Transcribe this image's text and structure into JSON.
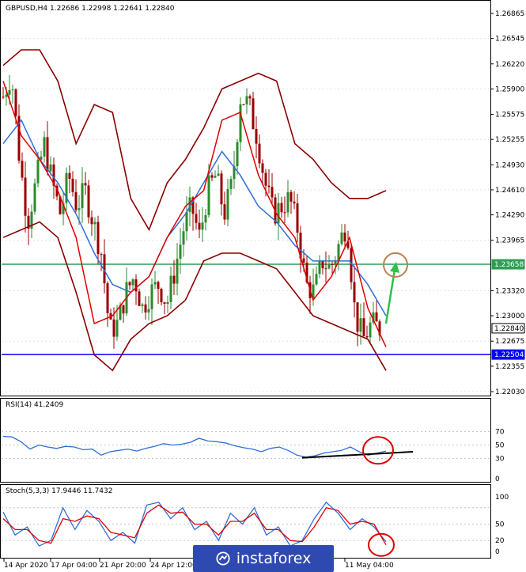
{
  "header": {
    "symbol_line": "GBPUSD,H4  1.22686 1.22998 1.22641 1.22840",
    "rsi_line": "RSI(14) 41.2409",
    "stoch_line": "Stoch(5,3,3) 17.9446 11.7432"
  },
  "price_axis": {
    "ticks": [
      "1.26865",
      "1.26545",
      "1.26220",
      "1.25900",
      "1.25575",
      "1.25255",
      "1.24930",
      "1.24610",
      "1.24290",
      "1.23965",
      "1.23320",
      "1.23000",
      "1.22675",
      "1.22355",
      "1.22030"
    ],
    "tick_values": [
      1.26865,
      1.26545,
      1.2622,
      1.259,
      1.25575,
      1.25255,
      1.2493,
      1.2461,
      1.2429,
      1.23965,
      1.2332,
      1.23,
      1.22675,
      1.22355,
      1.2203
    ],
    "boxes": [
      {
        "label": "1.23658",
        "value": 1.23658,
        "color": "#2e9e55"
      },
      {
        "label": "1.22840",
        "value": 1.2284,
        "color": "#ffffff"
      },
      {
        "label": "1.22504",
        "value": 1.22504,
        "color": "#0000ff"
      }
    ]
  },
  "rsi_axis": {
    "ticks": [
      "70",
      "50",
      "30",
      "0"
    ],
    "tick_values": [
      70,
      50,
      30,
      0
    ]
  },
  "stoch_axis": {
    "ticks": [
      "100",
      "50",
      "20",
      "0"
    ],
    "tick_values": [
      100,
      50,
      20,
      0
    ]
  },
  "time_axis": {
    "labels": [
      "14 Apr 2020",
      "17 Apr 04:00",
      "21 Apr 20:00",
      "24 Apr 12:00",
      "11 May 04:00"
    ]
  },
  "colors": {
    "bullish": "#2d8a2d",
    "bearish": "#9a0000",
    "bollinger": "#8b0000",
    "fast_ma": "#e00000",
    "slow_ma": "#2f6fd8",
    "support": "#0000ff",
    "resistance": "#2e9e55",
    "arrow": "#2fc04a",
    "circle_price": "#c08050",
    "circle_ind": "#e00000"
  },
  "watermark": {
    "text": "instaforex"
  },
  "chart_data": [
    {
      "type": "candlestick",
      "title": "GBPUSD,H4",
      "ylim": [
        1.22,
        1.27
      ],
      "horizontal_lines": [
        1.23658,
        1.22504
      ],
      "close_path": [
        1.258,
        1.261,
        1.25,
        1.242,
        1.247,
        1.252,
        1.247,
        1.243,
        1.248,
        1.244,
        1.246,
        1.242,
        1.238,
        1.228,
        1.229,
        1.233,
        1.235,
        1.231,
        1.233,
        1.234,
        1.2315,
        1.236,
        1.241,
        1.244,
        1.24,
        1.246,
        1.248,
        1.243,
        1.247,
        1.258,
        1.257,
        1.253,
        1.247,
        1.243,
        1.244,
        1.245,
        1.241,
        1.234,
        1.233,
        1.237,
        1.236,
        1.239,
        1.242,
        1.23,
        1.227,
        1.229,
        1.2284
      ],
      "bollinger_upper_path": [
        1.262,
        1.264,
        1.264,
        1.26,
        1.252,
        1.257,
        1.256,
        1.245,
        1.241,
        1.247,
        1.25,
        1.254,
        1.259,
        1.26,
        1.261,
        1.26,
        1.252,
        1.25,
        1.247,
        1.245,
        1.245,
        1.246
      ],
      "bollinger_lower_path": [
        1.24,
        1.241,
        1.242,
        1.24,
        1.233,
        1.225,
        1.223,
        1.227,
        1.229,
        1.23,
        1.232,
        1.237,
        1.238,
        1.238,
        1.237,
        1.236,
        1.233,
        1.23,
        1.229,
        1.228,
        1.227,
        1.223
      ],
      "fast_ma_path": [
        1.26,
        1.253,
        1.25,
        1.246,
        1.24,
        1.229,
        1.23,
        1.233,
        1.235,
        1.24,
        1.244,
        1.246,
        1.255,
        1.256,
        1.248,
        1.243,
        1.24,
        1.232,
        1.235,
        1.24,
        1.231,
        1.226
      ],
      "slow_ma_path": [
        1.252,
        1.255,
        1.25,
        1.247,
        1.243,
        1.238,
        1.234,
        1.233,
        1.235,
        1.24,
        1.243,
        1.247,
        1.251,
        1.248,
        1.244,
        1.242,
        1.239,
        1.237,
        1.237,
        1.237,
        1.234,
        1.23
      ],
      "projection_target": 1.2365
    },
    {
      "type": "line",
      "title": "RSI(14)",
      "ylim": [
        0,
        100
      ],
      "levels": [
        70,
        50,
        30
      ],
      "values": [
        63,
        62,
        55,
        44,
        50,
        47,
        45,
        48,
        47,
        43,
        44,
        35,
        40,
        42,
        44,
        41,
        45,
        48,
        52,
        50,
        51,
        54,
        60,
        56,
        55,
        53,
        49,
        46,
        44,
        40,
        45,
        47,
        42,
        35,
        32,
        34,
        38,
        40,
        42,
        47,
        40,
        35,
        38,
        41
      ],
      "trendline": [
        31,
        40
      ]
    },
    {
      "type": "line",
      "title": "Stoch(5,3,3)",
      "ylim": [
        0,
        100
      ],
      "levels": [
        80,
        50,
        20
      ],
      "main": [
        72,
        30,
        45,
        10,
        20,
        80,
        40,
        75,
        55,
        20,
        35,
        15,
        85,
        90,
        60,
        80,
        40,
        55,
        20,
        70,
        50,
        80,
        30,
        45,
        10,
        20,
        60,
        90,
        70,
        40,
        60,
        45,
        18
      ],
      "signal": [
        60,
        40,
        40,
        20,
        15,
        60,
        55,
        65,
        60,
        35,
        30,
        25,
        70,
        85,
        70,
        72,
        50,
        50,
        30,
        55,
        55,
        70,
        40,
        40,
        20,
        18,
        45,
        80,
        75,
        50,
        55,
        50,
        12
      ]
    }
  ]
}
